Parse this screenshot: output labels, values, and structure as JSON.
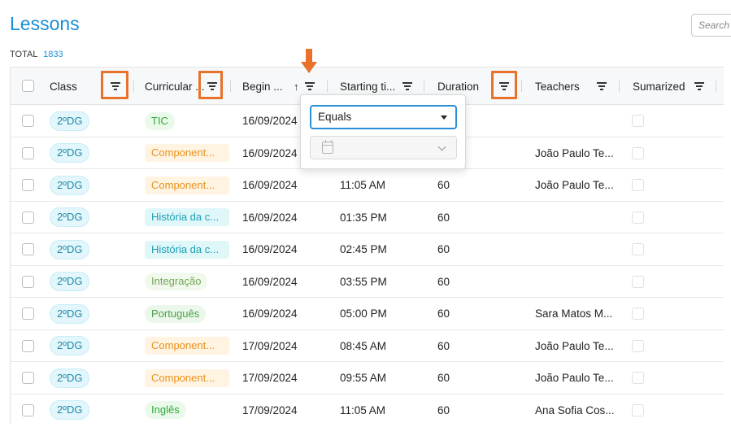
{
  "page": {
    "title": "Lessons",
    "total_label": "TOTAL",
    "total_count": "1833"
  },
  "search": {
    "placeholder": "Search"
  },
  "columns": {
    "class": "Class",
    "curricular": "Curricular ...",
    "begin": "Begin ...",
    "begin_sort": "↑",
    "starting": "Starting ti...",
    "duration": "Duration",
    "teachers": "Teachers",
    "sumarized": "Sumarized"
  },
  "filter_popup": {
    "operator": "Equals",
    "date_value": ""
  },
  "rows": [
    {
      "class": "2ºDG",
      "curricular": "TIC",
      "curricular_style": "green",
      "begin": "16/09/2024",
      "start": "",
      "duration": "",
      "teacher": ""
    },
    {
      "class": "2ºDG",
      "curricular": "Component...",
      "curricular_style": "orange",
      "begin": "16/09/2024",
      "start": "",
      "duration": "",
      "teacher": "João Paulo Te..."
    },
    {
      "class": "2ºDG",
      "curricular": "Component...",
      "curricular_style": "orange",
      "begin": "16/09/2024",
      "start": "11:05 AM",
      "duration": "60",
      "teacher": "João Paulo Te..."
    },
    {
      "class": "2ºDG",
      "curricular": "História da c...",
      "curricular_style": "cyan",
      "begin": "16/09/2024",
      "start": "01:35 PM",
      "duration": "60",
      "teacher": ""
    },
    {
      "class": "2ºDG",
      "curricular": "História da c...",
      "curricular_style": "cyan",
      "begin": "16/09/2024",
      "start": "02:45 PM",
      "duration": "60",
      "teacher": ""
    },
    {
      "class": "2ºDG",
      "curricular": "Integração",
      "curricular_style": "olive",
      "begin": "16/09/2024",
      "start": "03:55 PM",
      "duration": "60",
      "teacher": ""
    },
    {
      "class": "2ºDG",
      "curricular": "Português",
      "curricular_style": "port",
      "begin": "16/09/2024",
      "start": "05:00 PM",
      "duration": "60",
      "teacher": "Sara Matos M..."
    },
    {
      "class": "2ºDG",
      "curricular": "Component...",
      "curricular_style": "orange",
      "begin": "17/09/2024",
      "start": "08:45 AM",
      "duration": "60",
      "teacher": "João Paulo Te..."
    },
    {
      "class": "2ºDG",
      "curricular": "Component...",
      "curricular_style": "orange",
      "begin": "17/09/2024",
      "start": "09:55 AM",
      "duration": "60",
      "teacher": "João Paulo Te..."
    },
    {
      "class": "2ºDG",
      "curricular": "Inglês",
      "curricular_style": "green",
      "begin": "17/09/2024",
      "start": "11:05 AM",
      "duration": "60",
      "teacher": "Ana Sofia Cos..."
    }
  ],
  "colors": {
    "accent": "#1a8fd6",
    "highlight": "#e8722a"
  }
}
